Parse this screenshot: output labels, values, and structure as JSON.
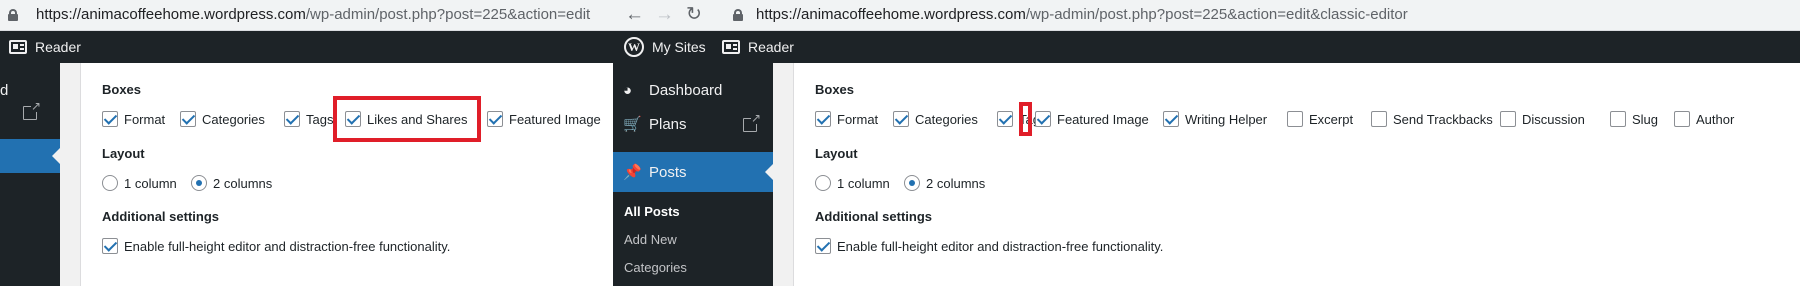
{
  "left": {
    "url_host": "https://animacoffeehome.wordpress.com",
    "url_path": "/wp-admin/post.php?post=225&action=edit",
    "adminbar": {
      "reader": "Reader"
    },
    "sidebar_partial_text": "d",
    "boxes_title": "Boxes",
    "boxes": [
      {
        "label": "Format",
        "checked": true
      },
      {
        "label": "Categories",
        "checked": true
      },
      {
        "label": "Tags",
        "checked": true
      },
      {
        "label": "Likes and Shares",
        "checked": true
      },
      {
        "label": "Featured Image",
        "checked": true
      }
    ],
    "layout_title": "Layout",
    "layout_options": [
      {
        "label": "1 column",
        "selected": false
      },
      {
        "label": "2 columns",
        "selected": true
      }
    ],
    "additional_title": "Additional settings",
    "additional_option": {
      "label": "Enable full-height editor and distraction-free functionality.",
      "checked": true
    }
  },
  "right": {
    "url_host": "https://animacoffeehome.wordpress.com",
    "url_path": "/wp-admin/post.php?post=225&action=edit&classic-editor",
    "nav_icons": [
      "back-arrow-icon",
      "forward-arrow-icon",
      "reload-icon"
    ],
    "adminbar": {
      "my_sites": "My Sites",
      "reader": "Reader"
    },
    "sidebar": {
      "items": [
        {
          "label": "Dashboard",
          "icon": "dashboard-icon"
        },
        {
          "label": "Plans",
          "icon": "cart-icon"
        },
        {
          "label": "Posts",
          "icon": "pin-icon",
          "current": true
        }
      ],
      "submenu": [
        "All Posts",
        "Add New",
        "Categories"
      ]
    },
    "boxes_title": "Boxes",
    "boxes": [
      {
        "label": "Format",
        "checked": true
      },
      {
        "label": "Categories",
        "checked": true
      },
      {
        "label": "Tags",
        "checked": true
      },
      {
        "label": "Featured Image",
        "checked": true
      },
      {
        "label": "Writing Helper",
        "checked": true
      },
      {
        "label": "Excerpt",
        "checked": false
      },
      {
        "label": "Send Trackbacks",
        "checked": false
      },
      {
        "label": "Discussion",
        "checked": false
      },
      {
        "label": "Slug",
        "checked": false
      },
      {
        "label": "Author",
        "checked": false
      }
    ],
    "layout_title": "Layout",
    "layout_options": [
      {
        "label": "1 column",
        "selected": false
      },
      {
        "label": "2 columns",
        "selected": true
      }
    ],
    "additional_title": "Additional settings",
    "additional_option": {
      "label": "Enable full-height editor and distraction-free functionality.",
      "checked": true
    }
  },
  "colors": {
    "admin_bar": "#1d2327",
    "accent": "#2271b1",
    "highlight": "#e01e29",
    "panel_bg": "#ffffff",
    "page_bg": "#f1f1f1"
  }
}
